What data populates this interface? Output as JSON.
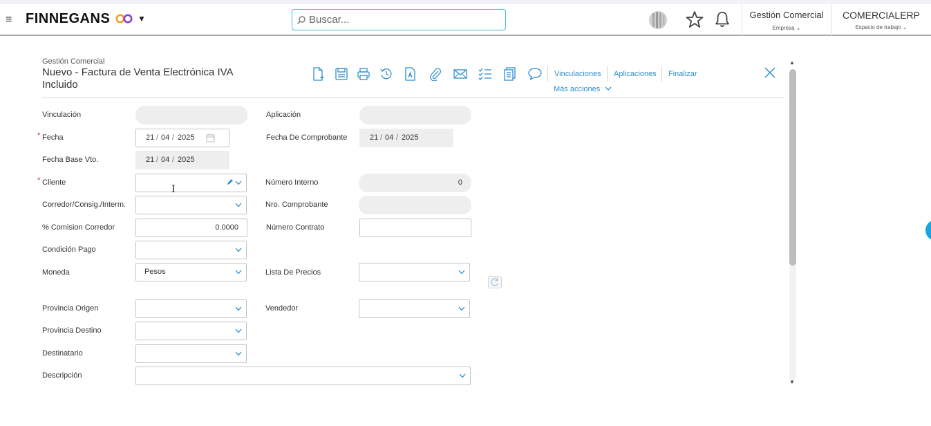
{
  "topbar": {
    "brand": "FINNEGANS",
    "search_placeholder": "Buscar...",
    "company": {
      "title": "Gestión Comercial",
      "sub": "Empresa ⌄"
    },
    "workspace": {
      "title": "COMERCIALERP",
      "sub": "Espacio de trabajo ⌄"
    }
  },
  "header": {
    "breadcrumb": "Gestión Comercial",
    "title": "Nuevo - Factura de Venta Electrónica IVA Incluido",
    "links": {
      "vinculaciones": "Vinculaciones",
      "aplicaciones": "Aplicaciones",
      "finalizar": "Finalizar",
      "mas_acciones": "Más acciones"
    }
  },
  "form": {
    "vinculacion": {
      "label": "Vinculación",
      "value": ""
    },
    "aplicacion": {
      "label": "Aplicación",
      "value": ""
    },
    "fecha": {
      "label": "Fecha",
      "d": "21",
      "m": "04",
      "y": "2025"
    },
    "fecha_comprobante": {
      "label": "Fecha De Comprobante",
      "d": "21",
      "m": "04",
      "y": "2025"
    },
    "fecha_base_vto": {
      "label": "Fecha Base Vto.",
      "d": "21",
      "m": "04",
      "y": "2025"
    },
    "cliente": {
      "label": "Cliente",
      "value": ""
    },
    "numero_interno": {
      "label": "Número Interno",
      "value": "0"
    },
    "corredor": {
      "label": "Corredor/Consig./Interm.",
      "value": ""
    },
    "nro_comprobante": {
      "label": "Nro. Comprobante",
      "value": ""
    },
    "comision": {
      "label": "% Comision Corredor",
      "value": "0.0000"
    },
    "numero_contrato": {
      "label": "Número Contrato",
      "value": ""
    },
    "condicion_pago": {
      "label": "Condición Pago",
      "value": ""
    },
    "moneda": {
      "label": "Moneda",
      "value": "Pesos"
    },
    "lista_precios": {
      "label": "Lista De Precios",
      "value": ""
    },
    "provincia_origen": {
      "label": "Provincia Origen",
      "value": ""
    },
    "vendedor": {
      "label": "Vendedor",
      "value": ""
    },
    "provincia_destino": {
      "label": "Provincia Destino",
      "value": ""
    },
    "destinatario": {
      "label": "Destinatario",
      "value": ""
    },
    "descripcion": {
      "label": "Descripción",
      "value": ""
    },
    "required_mark": "*"
  },
  "colors": {
    "accent": "#2d8fd0",
    "search_border": "#3db8d4",
    "required": "#d9302c",
    "readonly_bg": "#eeeeee"
  }
}
